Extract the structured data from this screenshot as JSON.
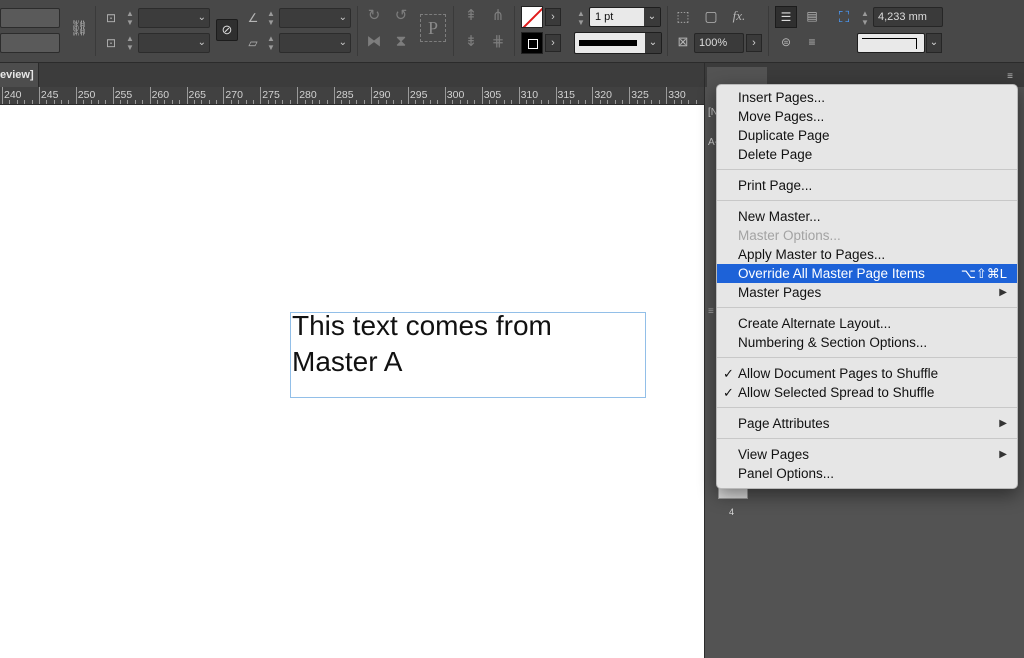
{
  "toolbar": {
    "stroke_weight": "1 pt",
    "opacity": "100%",
    "width_value": "4,233 mm",
    "text_frame_icon": "P",
    "fx_label": "fx."
  },
  "document": {
    "tab_label": "eview]",
    "ruler_ticks": [
      "240",
      "245",
      "250",
      "255",
      "260",
      "265",
      "270",
      "275",
      "280",
      "285",
      "290",
      "295",
      "300",
      "305",
      "310",
      "315",
      "320",
      "325",
      "330"
    ],
    "frame_text": "This text comes from Master A"
  },
  "panel": {
    "fragment_1": "[N",
    "fragment_2": "A-",
    "page_number": "4"
  },
  "menu": {
    "groups": [
      [
        {
          "label": "Insert Pages..."
        },
        {
          "label": "Move Pages..."
        },
        {
          "label": "Duplicate Page"
        },
        {
          "label": "Delete Page"
        }
      ],
      [
        {
          "label": "Print Page..."
        }
      ],
      [
        {
          "label": "New Master..."
        },
        {
          "label": "Master Options...",
          "disabled": true
        },
        {
          "label": "Apply Master to Pages..."
        },
        {
          "label": "Override All Master Page Items",
          "shortcut": "⌥⇧⌘L",
          "highlighted": true
        },
        {
          "label": "Master Pages",
          "submenu": true
        }
      ],
      [
        {
          "label": "Create Alternate Layout..."
        },
        {
          "label": "Numbering & Section Options..."
        }
      ],
      [
        {
          "label": "Allow Document Pages to Shuffle",
          "checked": true
        },
        {
          "label": "Allow Selected Spread to Shuffle",
          "checked": true
        }
      ],
      [
        {
          "label": "Page Attributes",
          "submenu": true
        }
      ],
      [
        {
          "label": "View Pages",
          "submenu": true
        },
        {
          "label": "Panel Options..."
        }
      ]
    ]
  },
  "colors": {
    "highlight": "#1d62d8",
    "frame_border": "#92bfe8"
  }
}
